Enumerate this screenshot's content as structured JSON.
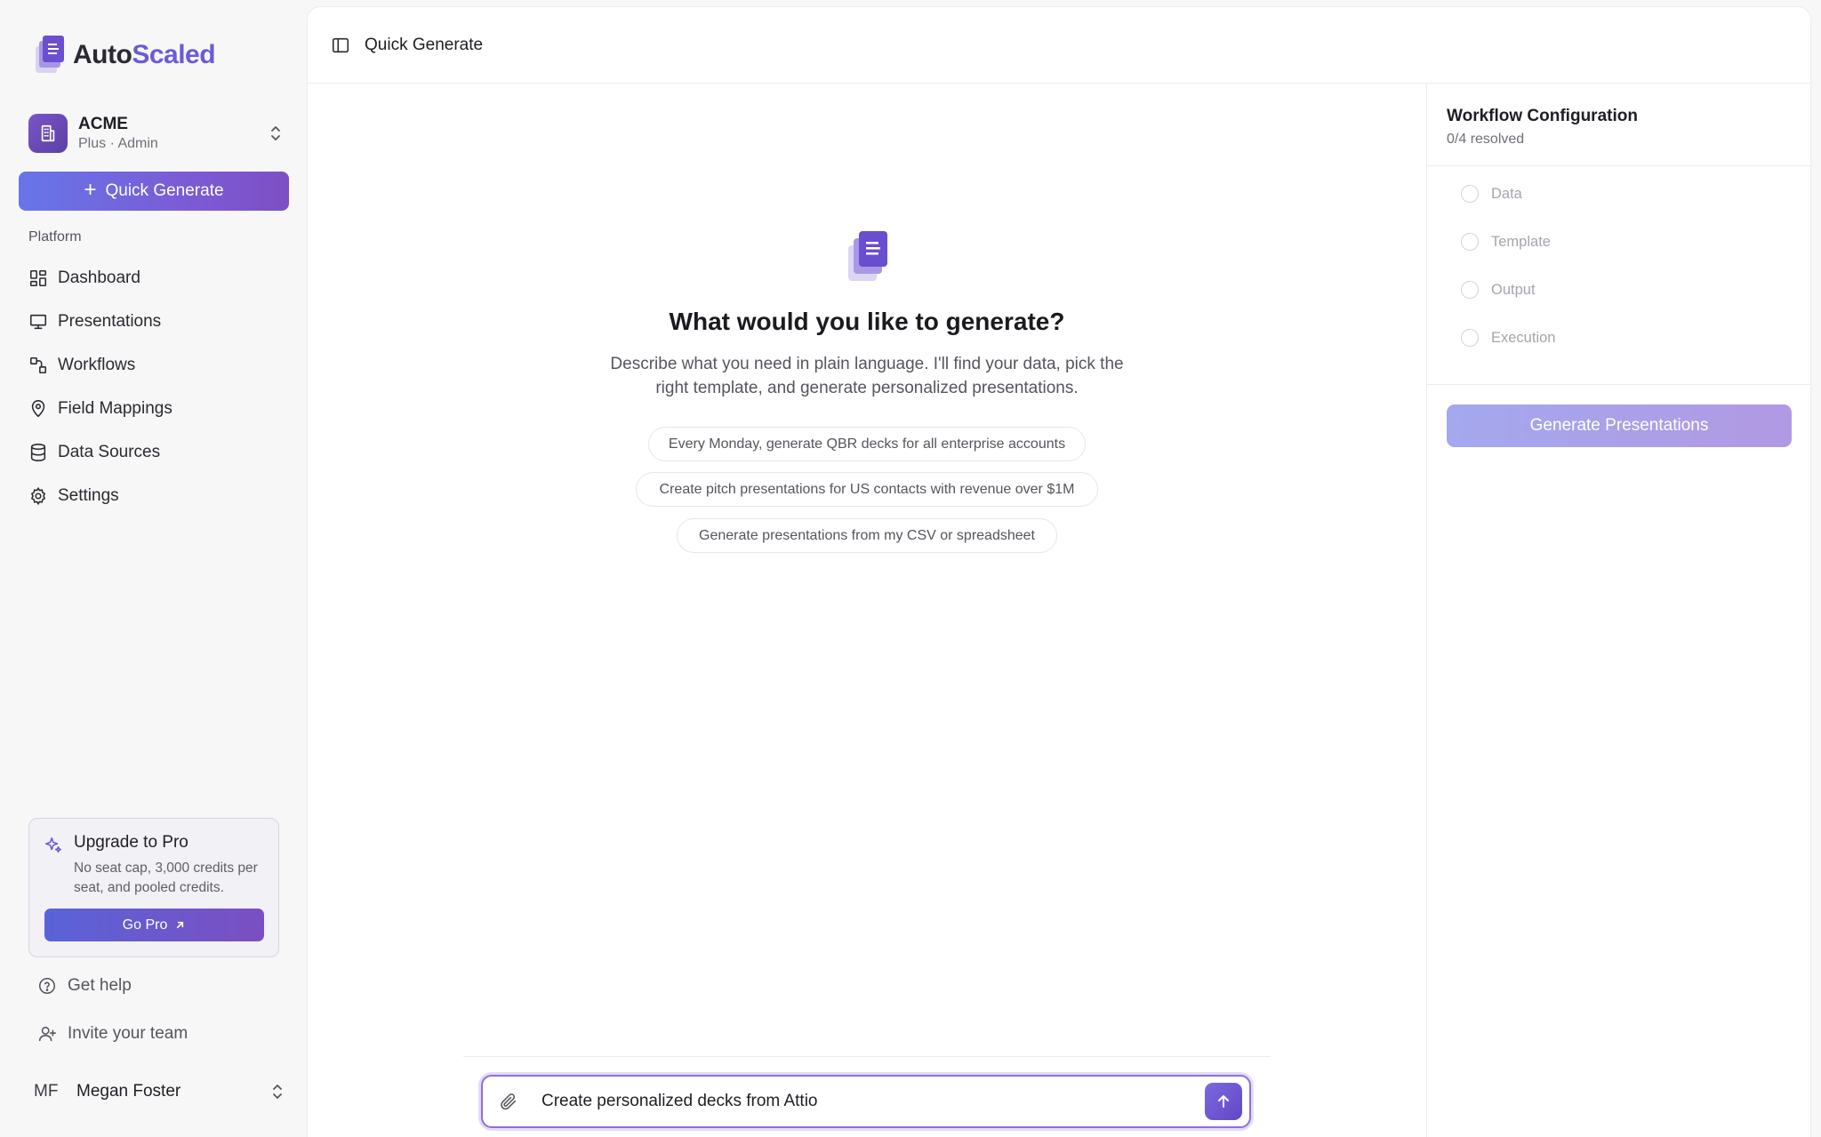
{
  "brand": {
    "name_part1": "Auto",
    "name_part2": "Scaled"
  },
  "org": {
    "name": "ACME",
    "subtitle": "Plus · Admin"
  },
  "sidebar": {
    "quick_generate_label": "Quick Generate",
    "section_label": "Platform",
    "items": [
      {
        "label": "Dashboard",
        "icon": "dashboard-icon"
      },
      {
        "label": "Presentations",
        "icon": "presentation-icon"
      },
      {
        "label": "Workflows",
        "icon": "workflow-icon"
      },
      {
        "label": "Field Mappings",
        "icon": "map-pin-icon"
      },
      {
        "label": "Data Sources",
        "icon": "database-icon"
      },
      {
        "label": "Settings",
        "icon": "gear-icon"
      }
    ],
    "upgrade": {
      "title": "Upgrade to Pro",
      "description": "No seat cap, 3,000 credits per seat, and pooled credits.",
      "button_label": "Go Pro"
    },
    "help_label": "Get help",
    "invite_label": "Invite your team",
    "user": {
      "initials": "MF",
      "name": "Megan Foster"
    }
  },
  "topbar": {
    "title": "Quick Generate"
  },
  "hero": {
    "title": "What would you like to generate?",
    "description": "Describe what you need in plain language. I'll find your data, pick the right template, and generate personalized presentations.",
    "suggestions": [
      "Every Monday, generate QBR decks for all enterprise accounts",
      "Create pitch presentations for US contacts with revenue over $1M",
      "Generate presentations from my CSV or spreadsheet"
    ]
  },
  "composer": {
    "value": "Create personalized decks from Attio"
  },
  "workflow": {
    "title": "Workflow Configuration",
    "status": "0/4 resolved",
    "steps": [
      "Data",
      "Template",
      "Output",
      "Execution"
    ],
    "generate_label": "Generate Presentations"
  },
  "colors": {
    "accent": "#6b5bd8",
    "accent_dark": "#5b3fa6",
    "disabled_button": "#a4a8ee"
  }
}
